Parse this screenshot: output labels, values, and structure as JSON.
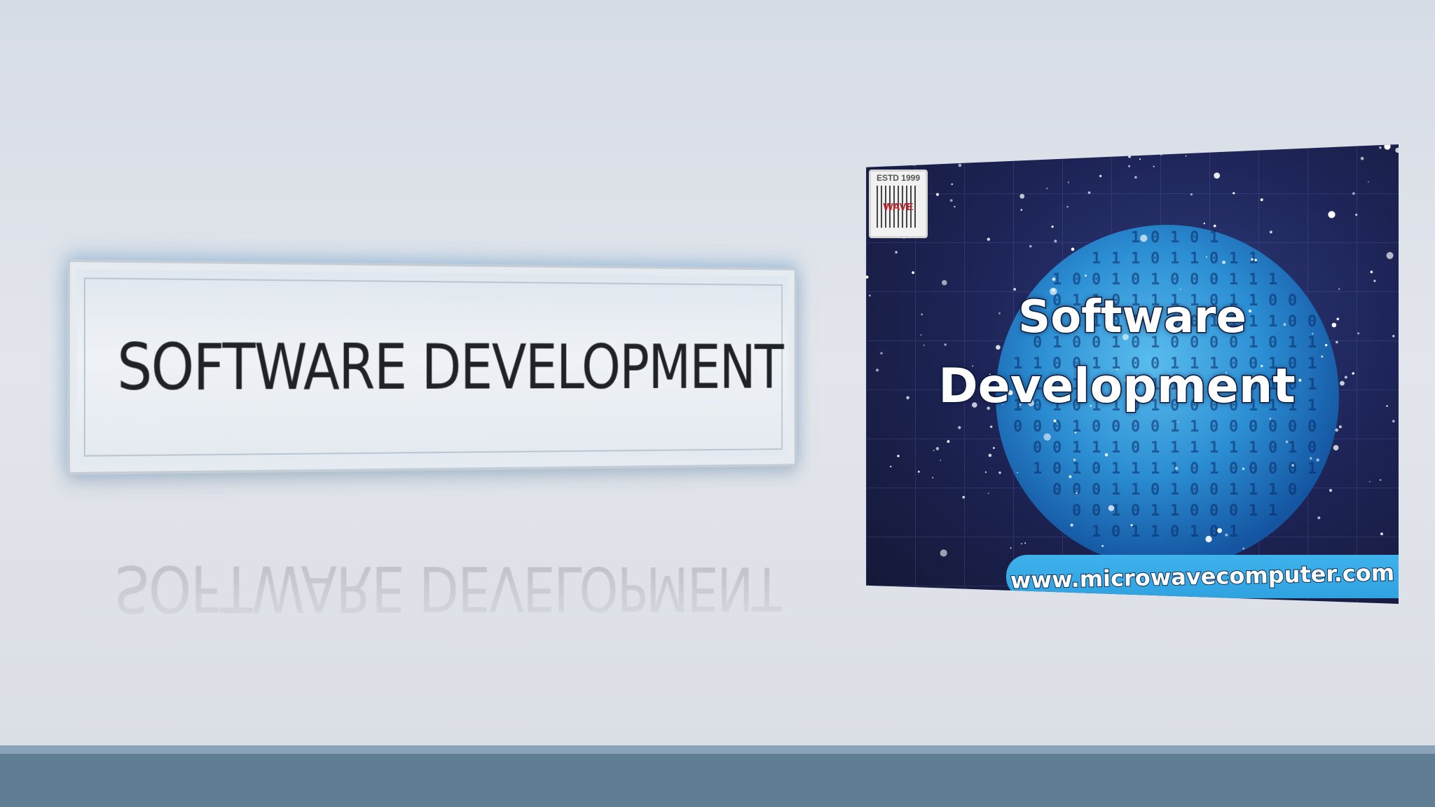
{
  "slide": {
    "title": "SOFTWARE DEVELOPMENT",
    "poster": {
      "logo": {
        "established": "ESTD 1999",
        "wordmark": "WAVE"
      },
      "heading_line1": "Software",
      "heading_line2": "Development",
      "url": "www.microwavecomputer.com"
    }
  },
  "colors": {
    "background": "#dde2e9",
    "banner_text": "#1f2226",
    "poster_sky": "#1e2558",
    "globe": "#2f9be0",
    "url_pill": "#3fb2ec",
    "footer_bar": "#5f7e94",
    "footer_line": "#8ba3b9"
  }
}
